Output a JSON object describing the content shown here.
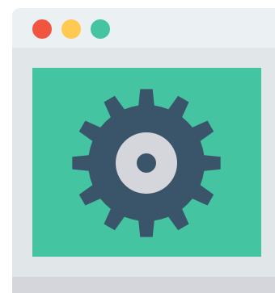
{
  "icon": {
    "name": "settings-window-icon",
    "content_icon": "gear-icon"
  },
  "colors": {
    "window_body": "#e1e6e9",
    "titlebar": "#ebf0f3",
    "footer": "#d5d6db",
    "dot_close": "#f1543f",
    "dot_minimize": "#ffc952",
    "dot_maximize": "#44c4a1",
    "content_bg": "#44c4a1",
    "gear": "#3a556a",
    "gear_hub": "#d5d6db"
  }
}
